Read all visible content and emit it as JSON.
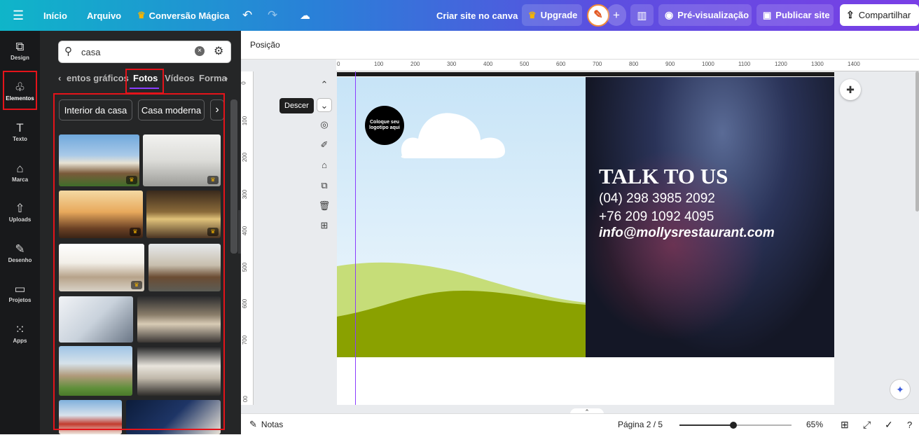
{
  "topbar": {
    "menu_icon": "hamburger-icon",
    "home": "Início",
    "file": "Arquivo",
    "magic": "Conversão Mágica",
    "create_site": "Criar site no canva",
    "upgrade": "Upgrade",
    "preview": "Pré-visualização",
    "publish": "Publicar site",
    "share": "Compartilhar"
  },
  "rail": [
    {
      "label": "Design",
      "icon": "design-icon"
    },
    {
      "label": "Elementos",
      "icon": "elements-icon"
    },
    {
      "label": "Texto",
      "icon": "text-icon"
    },
    {
      "label": "Marca",
      "icon": "brand-icon"
    },
    {
      "label": "Uploads",
      "icon": "upload-icon"
    },
    {
      "label": "Desenho",
      "icon": "draw-icon"
    },
    {
      "label": "Projetos",
      "icon": "folder-icon"
    },
    {
      "label": "Apps",
      "icon": "apps-icon"
    }
  ],
  "panel": {
    "search_value": "casa",
    "tabs": [
      "entos gráficos",
      "Fotos",
      "Vídeos",
      "Forma"
    ],
    "chips": [
      "Interior da casa",
      "Casa moderna"
    ]
  },
  "editor": {
    "position_label": "Posição",
    "ruler_x": [
      "0",
      "100",
      "200",
      "300",
      "400",
      "500",
      "600",
      "700",
      "800",
      "900",
      "1000",
      "1100",
      "1200",
      "1300",
      "1400"
    ],
    "ruler_y": [
      "0",
      "100",
      "200",
      "300",
      "400",
      "500",
      "600",
      "700",
      "00"
    ],
    "tooltip": "Descer",
    "logo_text": "Coloque seu logotipo aqui",
    "heading": "TALK TO US",
    "phone1": "(04) 298 3985 2092",
    "phone2": "+76 209 1092 4095",
    "email": "info@mollysrestaurant.com"
  },
  "bottombar": {
    "notes": "Notas",
    "page": "Página 2 / 5",
    "zoom": "65%",
    "zoom_level": 0.6
  },
  "colors": {
    "accent_red": "#e4131a",
    "tab_underline": "#8b3dff",
    "grass_dark": "#8aa100",
    "grass_light": "#c6dd78",
    "canvas_dark": "#141726"
  }
}
